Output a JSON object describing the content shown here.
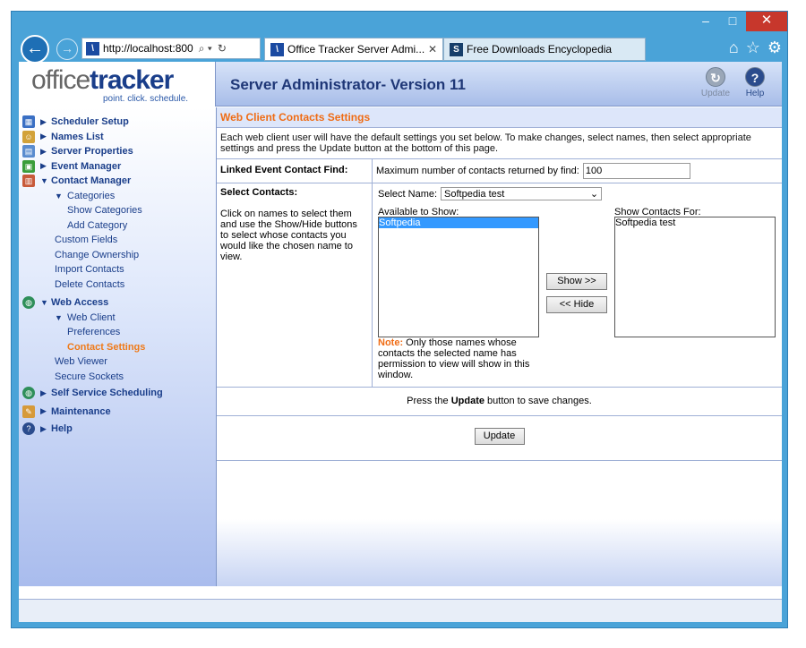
{
  "browser": {
    "address": "http://localhost:800",
    "tabs": [
      {
        "label": "Office Tracker Server Admi...",
        "active": true
      },
      {
        "label": "Free Downloads Encyclopedia",
        "active": false
      }
    ]
  },
  "header": {
    "logo_office": "office",
    "logo_tracker": "tracker",
    "logo_tagline": "point. click. schedule.",
    "title": "Server Administrator- Version 11",
    "update_label": "Update",
    "help_label": "Help"
  },
  "sidebar": {
    "items": [
      {
        "label": "Scheduler Setup",
        "icon_color": "#3a6fc4"
      },
      {
        "label": "Names List",
        "icon_color": "#d2a23a"
      },
      {
        "label": "Server Properties",
        "icon_color": "#5a8ccf"
      },
      {
        "label": "Event Manager",
        "icon_color": "#3a9d3a"
      },
      {
        "label": "Contact Manager",
        "icon_color": "#c85a3a"
      }
    ],
    "contact_sub": {
      "categories": "Categories",
      "show_categories": "Show Categories",
      "add_category": "Add Category",
      "custom_fields": "Custom Fields",
      "change_ownership": "Change Ownership",
      "import_contacts": "Import Contacts",
      "delete_contacts": "Delete Contacts"
    },
    "web_access": "Web Access",
    "web_sub": {
      "web_client": "Web Client",
      "preferences": "Preferences",
      "contact_settings": "Contact Settings",
      "web_viewer": "Web Viewer",
      "secure_sockets": "Secure Sockets"
    },
    "self_service": "Self Service Scheduling",
    "maintenance": "Maintenance",
    "help": "Help"
  },
  "main": {
    "section_title": "Web Client Contacts Settings",
    "intro": "Each web client user will have the default settings you set below. To make changes, select names, then select appropriate settings and press the Update button at the bottom of this page.",
    "linked_label": "Linked Event Contact Find:",
    "max_label": "Maximum number of contacts returned by find:",
    "max_value": "100",
    "select_contacts_label": "Select Contacts:",
    "select_help": "Click on names to select them and use the Show/Hide buttons to select whose contacts you would like the chosen name to view.",
    "select_name_label": "Select Name:",
    "select_name_value": "Softpedia test",
    "available_label": "Available to Show:",
    "available_items": [
      "Softpedia"
    ],
    "show_for_label": "Show Contacts For:",
    "show_for_items": [
      "Softpedia test"
    ],
    "show_btn": "Show >>",
    "hide_btn": "<< Hide",
    "note_label": "Note:",
    "note_text": "Only those names whose contacts the selected name has permission to view will show in this window.",
    "press_prefix": "Press the",
    "press_bold": "Update",
    "press_suffix": "button to save changes.",
    "update_btn": "Update"
  }
}
